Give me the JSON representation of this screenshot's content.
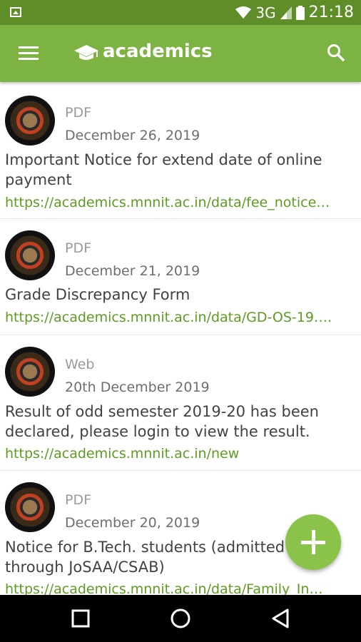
{
  "status_bar": {
    "network": "3G",
    "time": "21:18"
  },
  "app_bar": {
    "title": "academics",
    "menu_icon": "menu-icon",
    "logo_icon": "graduation-cap-icon",
    "search_icon": "search-icon"
  },
  "notices": [
    {
      "type": "PDF",
      "date": "December 26, 2019",
      "title": "Important Notice for extend date of online payment",
      "link": "https://academics.mnnit.ac.in/data/fee_notice…"
    },
    {
      "type": "PDF",
      "date": "December 21, 2019",
      "title": "Grade Discrepancy Form",
      "link": "https://academics.mnnit.ac.in/data/GD-OS-19…."
    },
    {
      "type": "Web",
      "date": "20th December 2019",
      "title": "Result of odd semester 2019-20 has been declared, please login to view the result.",
      "link": "https://academics.mnnit.ac.in/new"
    },
    {
      "type": "PDF",
      "date": "December 20, 2019",
      "title": "Notice for B.Tech. students (admitted through JoSAA/CSAB)",
      "link": "https://academics.mnnit.ac.in/data/Family_In…"
    }
  ],
  "fab": {
    "icon": "plus-icon"
  },
  "nav_bar": {
    "recents_icon": "square-icon",
    "home_icon": "circle-icon",
    "back_icon": "triangle-back-icon"
  },
  "colors": {
    "primary": "#7cb342",
    "status_bar": "#5f8e28",
    "accent": "#8bc34a",
    "link": "#5d9c21"
  }
}
